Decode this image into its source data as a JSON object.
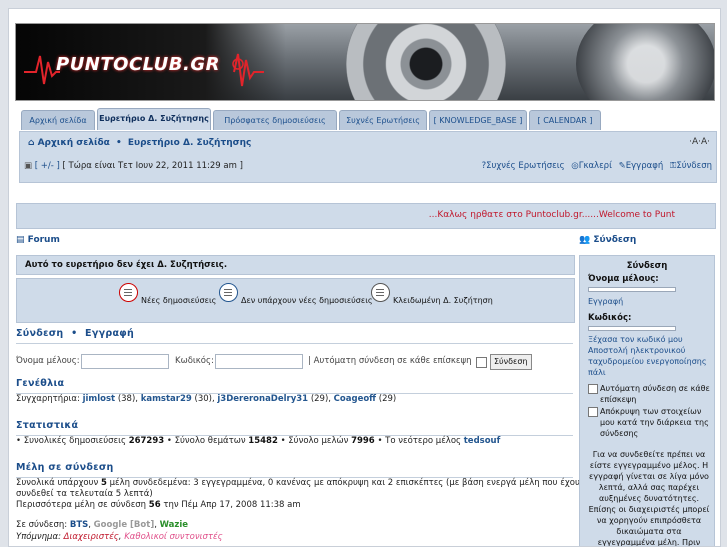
{
  "banner": {
    "logo_text": "PUNTOCLUB.GR"
  },
  "tabs": [
    {
      "label": "Αρχική σελίδα"
    },
    {
      "label": "Ευρετήριο Δ. Συζήτησης"
    },
    {
      "label": "Πρόσφατες δημοσιεύσεις"
    },
    {
      "label": "Συχνές Ερωτήσεις"
    },
    {
      "label": "[ KNOWLEDGE_BASE ]"
    },
    {
      "label": "[ CALENDAR ]"
    }
  ],
  "breadcrumb": {
    "home": "Αρχική σελίδα",
    "sep": "•",
    "index": "Ευρετήριο Δ. Συζήτησης"
  },
  "font_controls": "·A·A·",
  "timebar": {
    "expand": "[ +/- ]",
    "text": "[ Τώρα είναι Τετ Ιουν 22, 2011 11:29 am ]"
  },
  "quicklinks": {
    "faq": "Συχνές Ερωτήσεις",
    "gallery": "Γκαλερί",
    "register": "Εγγραφή",
    "login": "Σύνδεση"
  },
  "announcement": "...Καλως ηρθατε στο Puntoclub.gr......Welcome to Punt",
  "forum_link": "Forum",
  "login_link": "Σύνδεση",
  "notice": "Αυτό το ευρετήριο δεν έχει Δ. Συζητήσεις.",
  "legend": {
    "new_posts": "Νέες δημοσιεύσεις",
    "no_new_posts": "Δεν υπάρχουν νέες δημοσιεύσεις",
    "locked": "Κλειδωμένη Δ. Συζήτηση"
  },
  "login_section": {
    "title_login": "Σύνδεση",
    "title_sep": "•",
    "title_register": "Εγγραφή",
    "username_label": "Όνομα μέλους:",
    "password_label": "Κωδικός:",
    "autologin": "| Αυτόματη σύνδεση σε κάθε επίσκεψη",
    "submit": "Σύνδεση"
  },
  "birthdays": {
    "title": "Γενέθλια",
    "prefix": "Συγχαρητήρια:",
    "people": [
      {
        "name": "jimlost",
        "age": "(38),"
      },
      {
        "name": "kamstar29",
        "age": "(30),"
      },
      {
        "name": "j3DereronaDelry31",
        "age": "(29),"
      },
      {
        "name": "Coageoff",
        "age": "(29)"
      }
    ]
  },
  "stats": {
    "title": "Στατιστικά",
    "posts_label": "• Συνολικές δημοσιεύσεις",
    "posts": "267293",
    "topics_label": "• Σύνολο θεμάτων",
    "topics": "15482",
    "members_label": "• Σύνολο μελών",
    "members": "7996",
    "newest_label": "• Το νεότερο μέλος",
    "newest": "tedsouf"
  },
  "online": {
    "title": "Μέλη σε σύνδεση",
    "line1_pre": "Συνολικά υπάρχουν",
    "line1_count": "5",
    "line1_post": "μέλη συνδεδεμένα: 3 εγγεγραμμένα, 0 κανένας με απόκρυψη και 2 επισκέπτες (με βάση ενεργά μέλη που έχουν",
    "line2": "συνδεθεί τα τελευταία 5 λεπτά)",
    "line3_pre": "Περισσότερα μέλη σε σύνδεση",
    "line3_count": "56",
    "line3_post": "την Πέμ Απρ 17, 2008 11:38 am",
    "now_label": "Σε σύνδεση:",
    "now_bts": "BTS",
    "now_google": "Google [Bot]",
    "now_wazie": "Wazie",
    "legend_label": "Υπόμνημα:",
    "legend_admins": "Διαχειριστές",
    "legend_mods": "Καθολικοί συντονιστές"
  },
  "sidebar": {
    "title": "Σύνδεση",
    "username_label": "Όνομα μέλους:",
    "register_link": "Εγγραφή",
    "password_label": "Κωδικός:",
    "forgot_link": "Ξέχασα τον κωδικό μου",
    "resend_link": "Αποστολή ηλεκτρονικού ταχυδρομείου ενεργοποίησης πάλι",
    "autologin": "Αυτόματη σύνδεση σε κάθε επίσκεψη",
    "hide_status": "Απόκρυψη των στοιχείων μου κατά την διάρκεια της σύνδεσης",
    "info": "Για να συνδεθείτε πρέπει να είστε εγγεγραμμένο μέλος. Η εγγραφή γίνεται σε λίγα μόνο λεπτά, αλλά σας παρέχει αυξημένες δυνατότητες. Επίσης οι διαχειριστές μπορεί να χορηγούν επιπρόσθετα δικαιώματα στα εγγεγραμμένα μέλη. Πριν"
  },
  "colors": {
    "accent": "#1b4d8a",
    "panel": "#cfdbe9",
    "announce": "#c0182c",
    "admin": "#c0182c",
    "mod": "#e0508a",
    "bot": "#999999",
    "wazie": "#2a8f2a"
  }
}
